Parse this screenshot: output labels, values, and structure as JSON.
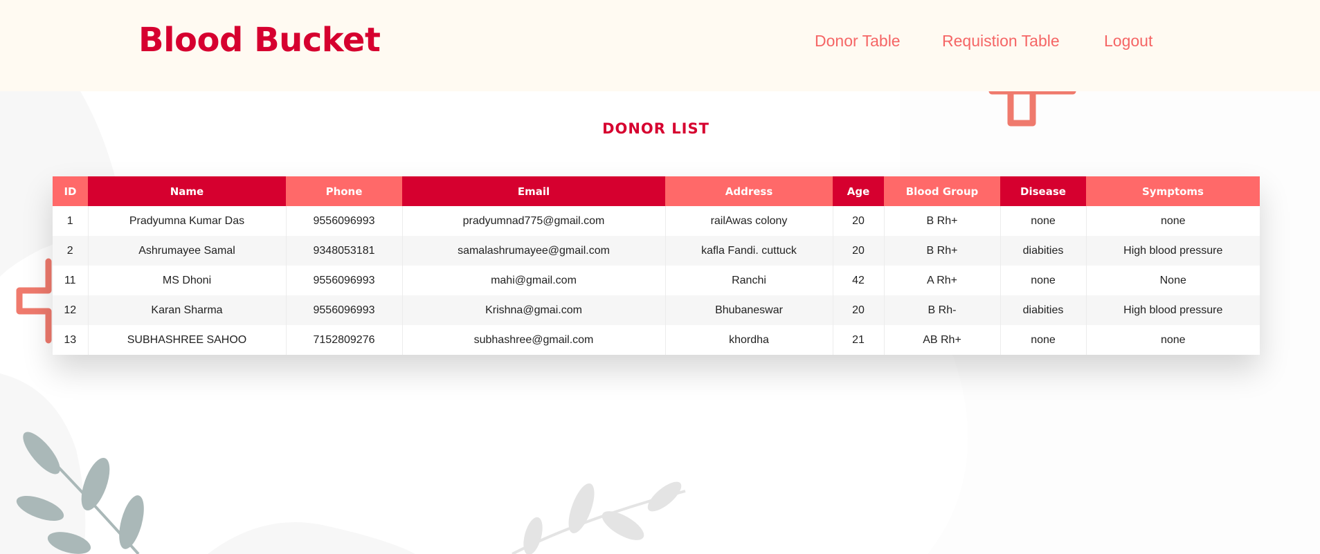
{
  "header": {
    "brand": "Blood Bucket",
    "nav": [
      "Donor Table",
      "Requistion Table",
      "Logout"
    ]
  },
  "main": {
    "title": "DONOR LIST",
    "table": {
      "columns": [
        "ID",
        "Name",
        "Phone",
        "Email",
        "Address",
        "Age",
        "Blood Group",
        "Disease",
        "Symptoms"
      ],
      "rows": [
        [
          "1",
          "Pradyumna Kumar Das",
          "9556096993",
          "pradyumnad775@gmail.com",
          "railAwas colony",
          "20",
          "B Rh+",
          "none",
          "none"
        ],
        [
          "2",
          "Ashrumayee Samal",
          "9348053181",
          "samalashrumayee@gmail.com",
          "kafla Fandi. cuttuck",
          "20",
          "B Rh+",
          "diabities",
          "High blood pressure"
        ],
        [
          "11",
          "MS Dhoni",
          "9556096993",
          "mahi@gmail.com",
          "Ranchi",
          "42",
          "A Rh+",
          "none",
          "None"
        ],
        [
          "12",
          "Karan Sharma",
          "9556096993",
          "Krishna@gmai.com",
          "Bhubaneswar",
          "20",
          "B Rh-",
          "diabities",
          "High blood pressure"
        ],
        [
          "13",
          "SUBHASHREE SAHOO",
          "7152809276",
          "subhashree@gmail.com",
          "khordha",
          "21",
          "AB Rh+",
          "none",
          "none"
        ]
      ]
    }
  },
  "colors": {
    "brand": "#d6002f",
    "nav": "#f56565",
    "header_bg": "#fffaf2",
    "th_dark": "#d6002f",
    "th_light": "#ff6969",
    "row_alt": "#f6f6f6"
  }
}
